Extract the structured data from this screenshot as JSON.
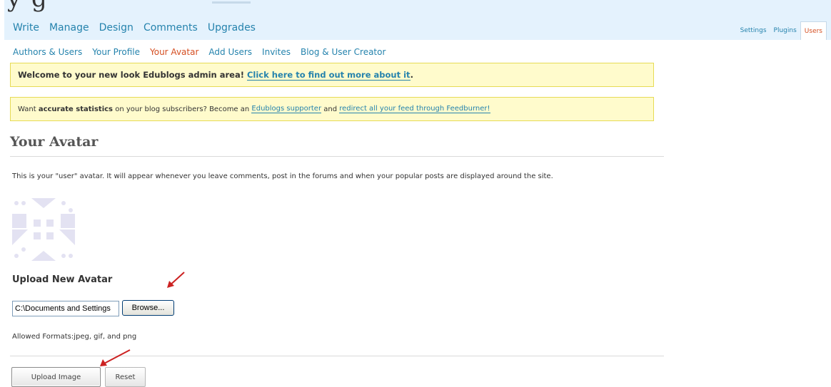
{
  "header": {
    "blog_title_fragment": "y g",
    "main_nav": [
      "Write",
      "Manage",
      "Design",
      "Comments",
      "Upgrades"
    ],
    "right_nav": [
      "Settings",
      "Plugins",
      "Users"
    ],
    "active_right_nav": "Users"
  },
  "sub_nav": {
    "items": [
      "Authors & Users",
      "Your Profile",
      "Your Avatar",
      "Add Users",
      "Invites",
      "Blog & User Creator"
    ],
    "current": "Your Avatar"
  },
  "notices": {
    "welcome_text": "Welcome to your new look Edublogs admin area!",
    "welcome_link": "Click here to find out more about it",
    "welcome_end": ".",
    "stats_prefix": "Want ",
    "stats_bold": "accurate statistics",
    "stats_mid": " on your blog subscribers? Become an ",
    "stats_link1": "Edublogs supporter",
    "stats_and": " and ",
    "stats_link2": "redirect all your feed through Feedburner!"
  },
  "page": {
    "title": "Your Avatar",
    "intro": "This is your \"user\" avatar. It will appear whenever you leave comments, post in the forums and when your popular posts are displayed around the site.",
    "upload_heading": "Upload New Avatar",
    "file_value": "C:\\Documents and Settings",
    "browse_label": "Browse...",
    "formats": "Allowed Formats:jpeg, gif, and png",
    "upload_label": "Upload Image",
    "reset_label": "Reset"
  },
  "colors": {
    "header_bg": "#e4f2fd",
    "link": "#2583ad",
    "current": "#d54e21",
    "notice_bg": "#fffbcc",
    "annotation_arrow": "#cc2222"
  },
  "icons": {
    "avatar": "identicon-avatar",
    "annotation": "red-arrow-icon"
  }
}
